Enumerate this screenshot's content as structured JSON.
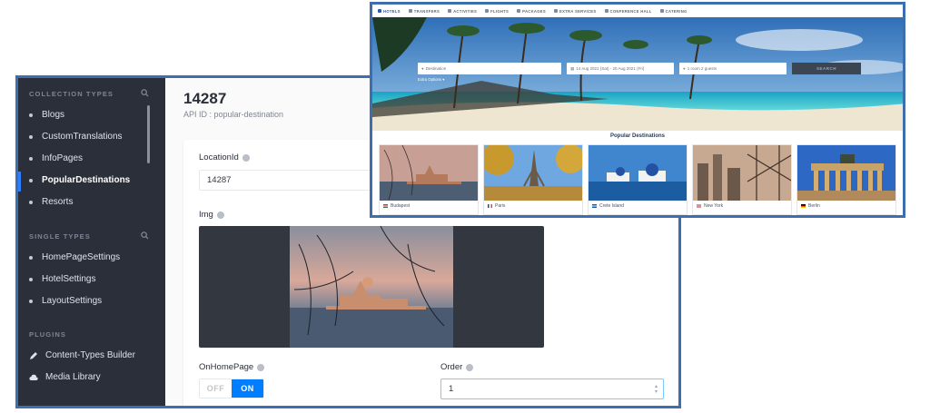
{
  "admin": {
    "sidebar": {
      "collection_types_heading": "COLLECTION TYPES",
      "collection_types": [
        {
          "label": "Blogs"
        },
        {
          "label": "CustomTranslations"
        },
        {
          "label": "InfoPages"
        },
        {
          "label": "PopularDestinations",
          "active": true
        },
        {
          "label": "Resorts"
        }
      ],
      "single_types_heading": "SINGLE TYPES",
      "single_types": [
        {
          "label": "HomePageSettings"
        },
        {
          "label": "HotelSettings"
        },
        {
          "label": "LayoutSettings"
        }
      ],
      "plugins_heading": "PLUGINS",
      "plugins": [
        {
          "label": "Content-Types Builder",
          "icon": "pencil-icon"
        },
        {
          "label": "Media Library",
          "icon": "cloud-icon"
        }
      ]
    },
    "entry": {
      "title": "14287",
      "api_id": "API ID : popular-destination"
    },
    "fields": {
      "location_id_label": "LocationId",
      "location_id_value": "14287",
      "img_label": "Img",
      "on_home_page_label": "OnHomePage",
      "toggle_off": "OFF",
      "toggle_on": "ON",
      "order_label": "Order",
      "order_value": "1"
    },
    "accent_color": "#007eff"
  },
  "site": {
    "nav": [
      {
        "label": "HOTELS",
        "active": true
      },
      {
        "label": "TRANSFERS"
      },
      {
        "label": "ACTIVITIES"
      },
      {
        "label": "FLIGHTS"
      },
      {
        "label": "PACKAGES"
      },
      {
        "label": "EXTRA SERVICES"
      },
      {
        "label": "CONFERENCE HALL"
      },
      {
        "label": "CATERING"
      }
    ],
    "search": {
      "destination_placeholder": "Destination",
      "dates": "14 Aug 2021 (Sat) - 20 Aug 2021 (Fri)",
      "guests": "1 room 2 guests",
      "button": "SEARCH",
      "extra_options": "Extra Options"
    },
    "popular_title": "Popular Destinations",
    "destinations": [
      {
        "name": "Budapest",
        "flag": "hungary-flag"
      },
      {
        "name": "Paris",
        "flag": "france-flag"
      },
      {
        "name": "Crete Island",
        "flag": "greece-flag"
      },
      {
        "name": "New York",
        "flag": "usa-flag"
      },
      {
        "name": "Berlin",
        "flag": "germany-flag"
      }
    ]
  }
}
